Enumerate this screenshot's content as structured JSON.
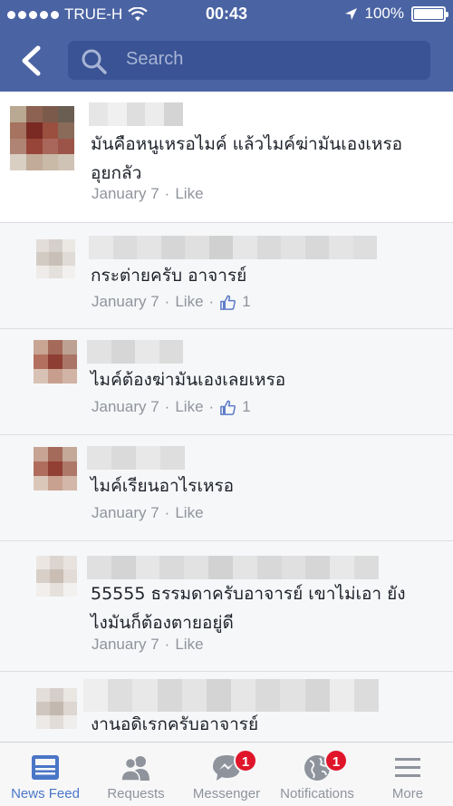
{
  "status_bar": {
    "carrier": "TRUE-H",
    "time": "00:43",
    "battery": "100%"
  },
  "nav": {
    "search_placeholder": "Search"
  },
  "comments": [
    {
      "text_line1": "มันคือหนูเหรอไมค์  แล้วไมค์ฆ่ามันเองเหรอ",
      "text_line2": "อุยกลัว",
      "date": "January 7",
      "like_label": "Like"
    },
    {
      "text_line1": "กระต่ายครับ อาจารย์",
      "date": "January 7",
      "like_label": "Like",
      "likes": "1"
    },
    {
      "text_line1": "ไมค์ต้องฆ่ามันเองเลยเหรอ",
      "date": "January 7",
      "like_label": "Like",
      "likes": "1"
    },
    {
      "text_line1": "ไมค์เรียนอาไรเหรอ",
      "date": "January 7",
      "like_label": "Like"
    },
    {
      "text_line1": "55555 ธรรมดาครับอาจารย์ เขาไม่เอา ยัง",
      "text_line2": "ไงมันก็ต้องตายอยู่ดี",
      "date": "January 7",
      "like_label": "Like"
    },
    {
      "text_line1": "งานอดิเรกครับอาจารย์"
    }
  ],
  "tabs": [
    {
      "label": "News Feed",
      "icon": "news-feed-icon",
      "active": true
    },
    {
      "label": "Requests",
      "icon": "friend-requests-icon"
    },
    {
      "label": "Messenger",
      "icon": "messenger-icon",
      "badge": "1"
    },
    {
      "label": "Notifications",
      "icon": "globe-icon",
      "badge": "1"
    },
    {
      "label": "More",
      "icon": "hamburger-icon"
    }
  ],
  "colors": {
    "header": "#4a63a3",
    "search_field": "#3a5394",
    "active_tab": "#4a76c7",
    "badge": "#e0152a",
    "meta_text": "#90949c"
  }
}
